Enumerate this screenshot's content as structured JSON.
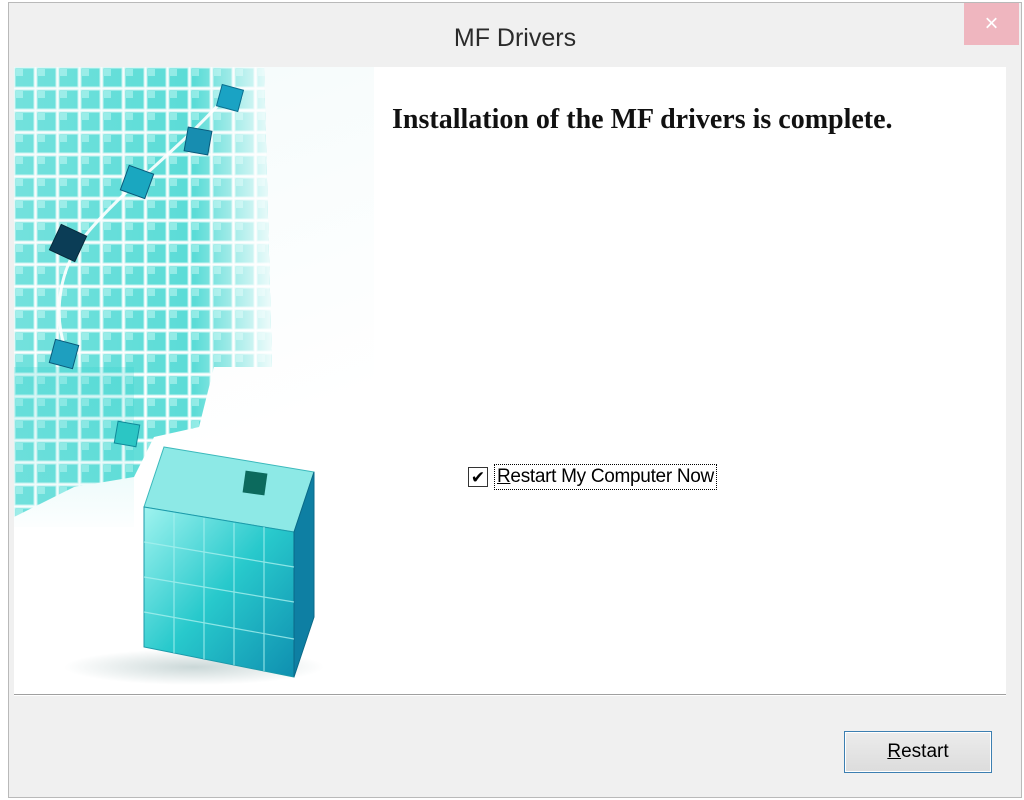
{
  "window": {
    "title": "MF Drivers",
    "close_label": "×"
  },
  "main": {
    "heading": "Installation of the MF drivers is complete.",
    "restart_checkbox": {
      "label_first": "R",
      "label_rest": "estart My Computer Now",
      "checked": true,
      "check_mark": "✔"
    }
  },
  "footer": {
    "restart_button": {
      "label_first": "R",
      "label_rest": "estart"
    }
  },
  "colors": {
    "graphic_cyan": "#1fd1d1",
    "graphic_deep": "#0a7fa8",
    "close_bg": "#efb6bf",
    "button_border": "#3c7fb1"
  }
}
